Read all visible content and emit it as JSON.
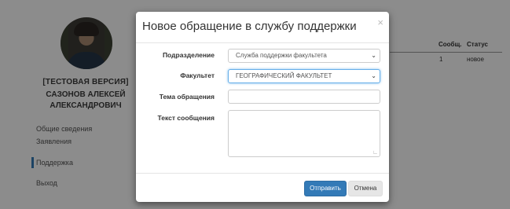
{
  "profile": {
    "test_version": "[ТЕСТОВАЯ ВЕРСИЯ]",
    "name_line1": "САЗОНОВ АЛЕКСЕЙ",
    "name_line2": "АЛЕКСАНДРОВИЧ"
  },
  "nav": [
    {
      "label": "Общие сведения"
    },
    {
      "label": "Заявления"
    },
    {
      "label": "Поддержка"
    },
    {
      "label": "Выход"
    }
  ],
  "table": {
    "headers": [
      "Сообщ.",
      "Статус"
    ],
    "row": [
      "1",
      "новое"
    ]
  },
  "modal": {
    "title": "Новое обращение в службу поддержки",
    "close": "×",
    "fields": {
      "department_label": "Подразделение",
      "department_value": "Служба поддержки факультета",
      "faculty_label": "Факультет",
      "faculty_value": "ГЕОГРАФИЧЕСКИЙ ФАКУЛЬТЕТ",
      "subject_label": "Тема обращения",
      "subject_value": "",
      "message_label": "Текст сообщения",
      "message_value": ""
    },
    "buttons": {
      "submit": "Отправить",
      "cancel": "Отмена"
    }
  },
  "colors": {
    "primary": "#337ab7",
    "backdrop": "rgba(0,0,0,0.45)"
  }
}
